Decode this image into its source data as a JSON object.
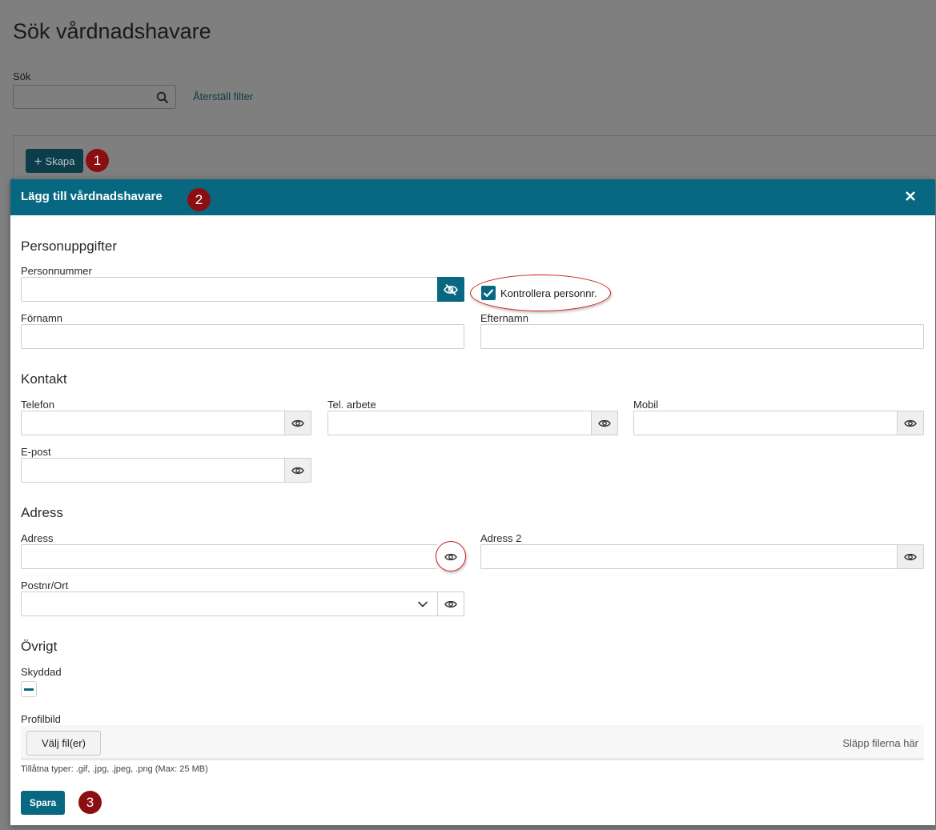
{
  "page": {
    "title": "Sök vårdnadshavare",
    "search_label": "Sök",
    "search_value": "",
    "reset_filter": "Återställ filter",
    "create_label": "Skapa"
  },
  "badges": [
    "1",
    "2",
    "3"
  ],
  "modal": {
    "title": "Lägg till vårdnadshavare",
    "sections": {
      "person": "Personuppgifter",
      "contact": "Kontakt",
      "address": "Adress",
      "other": "Övrigt"
    },
    "fields": {
      "personnummer": "Personnummer",
      "fornamn": "Förnamn",
      "efternamn": "Efternamn",
      "telefon": "Telefon",
      "tel_arbete": "Tel. arbete",
      "mobil": "Mobil",
      "epost": "E-post",
      "adress": "Adress",
      "adress2": "Adress 2",
      "postnr_ort": "Postnr/Ort",
      "skyddad": "Skyddad",
      "profilbild": "Profilbild"
    },
    "check_personnr": {
      "label": "Kontrollera personnr.",
      "checked": true
    },
    "file": {
      "choose_label": "Välj fil(er)",
      "drop_hint": "Släpp filerna här",
      "allowed_types": "Tillåtna typer: .gif, .jpg, .jpeg, .png  (Max: 25 MB)"
    },
    "save_label": "Spara"
  },
  "colors": {
    "header": "#086882",
    "badge": "#8b0f12",
    "annotation": "#d21a1a"
  },
  "icons": {
    "search": "search-icon",
    "close": "close-icon",
    "eye": "eye-icon",
    "eye_off": "eye-off-icon",
    "chevron": "chevron-down-icon",
    "check": "check-icon"
  }
}
